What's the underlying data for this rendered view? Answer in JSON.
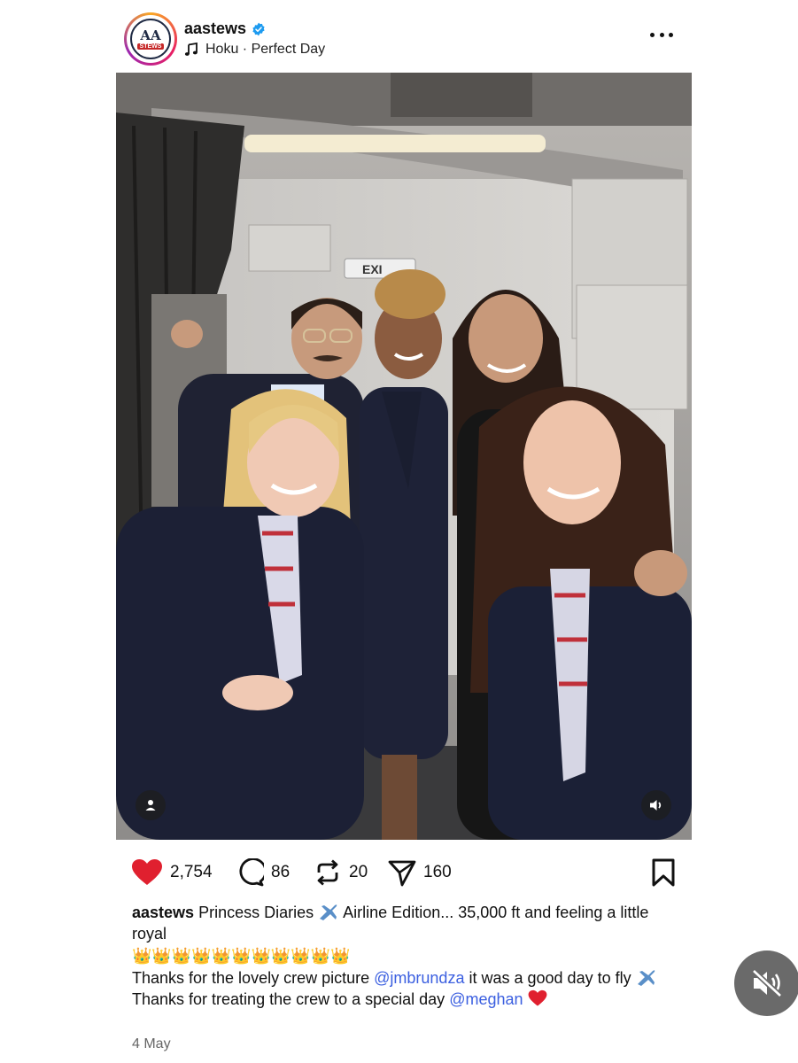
{
  "header": {
    "username": "aastews",
    "avatar_logo_top": "AA",
    "avatar_logo_bottom": "STEWS",
    "music": "Hoku · Perfect Day"
  },
  "photo": {
    "exit_sign": "EXI"
  },
  "actions": {
    "likes": "2,754",
    "comments": "86",
    "reposts": "20",
    "shares": "160"
  },
  "caption": {
    "username": "aastews",
    "line1_a": "Princess Diaries",
    "line1_b": "Airline Edition... 35,000 ft and feeling a little royal",
    "crowns": "👑👑👑👑👑👑👑👑👑👑👑",
    "line2_a": "Thanks for the lovely crew picture",
    "mention1": "@jmbrundza",
    "line2_b": "it was a good day to fly",
    "line3_a": "Thanks for treating the crew to a special day",
    "mention2": "@meghan"
  },
  "date": "4 May",
  "colors": {
    "heart": "#e0202f",
    "mention": "#3b5fe0",
    "verified": "#1d9bf0"
  },
  "icons": [
    "verified-icon",
    "music-note-icon",
    "more-icon",
    "heart-icon",
    "comment-icon",
    "repost-icon",
    "share-icon",
    "bookmark-icon",
    "person-tag-icon",
    "volume-icon",
    "mute-icon",
    "airplane-icon"
  ]
}
